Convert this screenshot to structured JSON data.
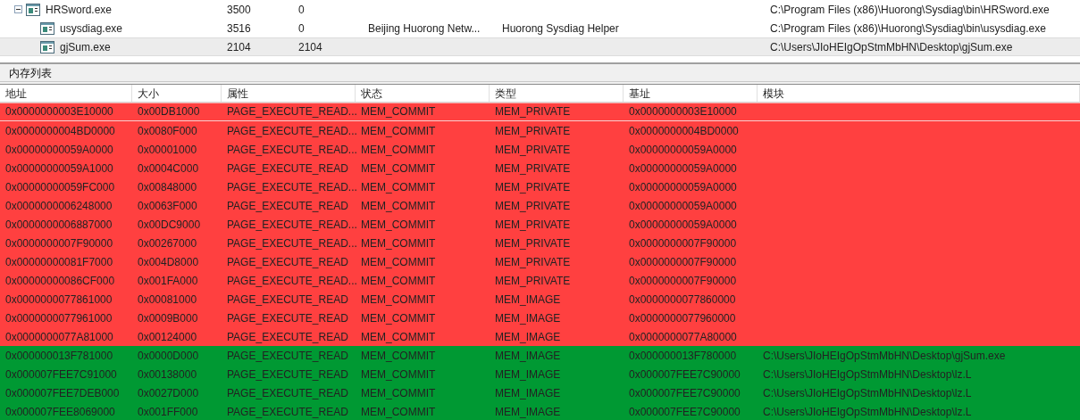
{
  "processes": [
    {
      "name": "HRSword.exe",
      "pid": "3500",
      "parent_pid": "0",
      "path": "C:\\Program Files (x86)\\Huorong\\Sysdiag\\bin\\HRSword.exe",
      "expanded": true,
      "selected": false,
      "children": [
        {
          "name": "usysdiag.exe",
          "pid": "3516",
          "parent_pid": "0",
          "company": "Beijing Huorong Netw...",
          "description": "Huorong Sysdiag Helper",
          "path": "C:\\Program Files (x86)\\Huorong\\Sysdiag\\bin\\usysdiag.exe",
          "selected": false
        },
        {
          "name": "gjSum.exe",
          "pid": "2104",
          "parent_pid": "2104",
          "path": "C:\\Users\\JIoHEIgOpStmMbHN\\Desktop\\gjSum.exe",
          "selected": true
        }
      ]
    }
  ],
  "memory_panel": {
    "title": "内存列表",
    "columns": [
      "地址",
      "大小",
      "属性",
      "状态",
      "类型",
      "基址",
      "模块"
    ],
    "rows": [
      {
        "cells": [
          "0x0000000003E10000",
          "0x00DB1000",
          "PAGE_EXECUTE_READ...",
          "MEM_COMMIT",
          "MEM_PRIVATE",
          "0x0000000003E10000"
        ],
        "color": "#ff4040",
        "selected": true
      },
      {
        "cells": [
          "0x0000000004BD0000",
          "0x0080F000",
          "PAGE_EXECUTE_READ...",
          "MEM_COMMIT",
          "MEM_PRIVATE",
          "0x0000000004BD0000"
        ],
        "color": "#ff4040",
        "selected": false
      },
      {
        "cells": [
          "0x00000000059A0000",
          "0x00001000",
          "PAGE_EXECUTE_READ...",
          "MEM_COMMIT",
          "MEM_PRIVATE",
          "0x00000000059A0000"
        ],
        "color": "#ff4040",
        "selected": false
      },
      {
        "cells": [
          "0x00000000059A1000",
          "0x0004C000",
          "PAGE_EXECUTE_READ",
          "MEM_COMMIT",
          "MEM_PRIVATE",
          "0x00000000059A0000"
        ],
        "color": "#ff4040",
        "selected": false
      },
      {
        "cells": [
          "0x00000000059FC000",
          "0x00848000",
          "PAGE_EXECUTE_READ...",
          "MEM_COMMIT",
          "MEM_PRIVATE",
          "0x00000000059A0000"
        ],
        "color": "#ff4040",
        "selected": false
      },
      {
        "cells": [
          "0x0000000006248000",
          "0x0063F000",
          "PAGE_EXECUTE_READ",
          "MEM_COMMIT",
          "MEM_PRIVATE",
          "0x00000000059A0000"
        ],
        "color": "#ff4040",
        "selected": false
      },
      {
        "cells": [
          "0x0000000006887000",
          "0x00DC9000",
          "PAGE_EXECUTE_READ...",
          "MEM_COMMIT",
          "MEM_PRIVATE",
          "0x00000000059A0000"
        ],
        "color": "#ff4040",
        "selected": false
      },
      {
        "cells": [
          "0x0000000007F90000",
          "0x00267000",
          "PAGE_EXECUTE_READ...",
          "MEM_COMMIT",
          "MEM_PRIVATE",
          "0x0000000007F90000"
        ],
        "color": "#ff4040",
        "selected": false
      },
      {
        "cells": [
          "0x00000000081F7000",
          "0x004D8000",
          "PAGE_EXECUTE_READ",
          "MEM_COMMIT",
          "MEM_PRIVATE",
          "0x0000000007F90000"
        ],
        "color": "#ff4040",
        "selected": false
      },
      {
        "cells": [
          "0x00000000086CF000",
          "0x001FA000",
          "PAGE_EXECUTE_READ...",
          "MEM_COMMIT",
          "MEM_PRIVATE",
          "0x0000000007F90000"
        ],
        "color": "#ff4040",
        "selected": false
      },
      {
        "cells": [
          "0x0000000077861000",
          "0x00081000",
          "PAGE_EXECUTE_READ",
          "MEM_COMMIT",
          "MEM_IMAGE",
          "0x0000000077860000"
        ],
        "color": "#ff4040",
        "selected": false
      },
      {
        "cells": [
          "0x0000000077961000",
          "0x0009B000",
          "PAGE_EXECUTE_READ",
          "MEM_COMMIT",
          "MEM_IMAGE",
          "0x0000000077960000"
        ],
        "color": "#ff4040",
        "selected": false
      },
      {
        "cells": [
          "0x0000000077A81000",
          "0x00124000",
          "PAGE_EXECUTE_READ",
          "MEM_COMMIT",
          "MEM_IMAGE",
          "0x0000000077A80000"
        ],
        "color": "#ff4040",
        "selected": false
      },
      {
        "cells": [
          "0x000000013F781000",
          "0x0000D000",
          "PAGE_EXECUTE_READ",
          "MEM_COMMIT",
          "MEM_IMAGE",
          "0x000000013F780000",
          "C:\\Users\\JIoHEIgOpStmMbHN\\Desktop\\gjSum.exe"
        ],
        "color": "#009933",
        "selected": false
      },
      {
        "cells": [
          "0x000007FEE7C91000",
          "0x00138000",
          "PAGE_EXECUTE_READ",
          "MEM_COMMIT",
          "MEM_IMAGE",
          "0x000007FEE7C90000",
          "C:\\Users\\JIoHEIgOpStmMbHN\\Desktop\\lz.L"
        ],
        "color": "#009933",
        "selected": false
      },
      {
        "cells": [
          "0x000007FEE7DEB000",
          "0x0027D000",
          "PAGE_EXECUTE_READ",
          "MEM_COMMIT",
          "MEM_IMAGE",
          "0x000007FEE7C90000",
          "C:\\Users\\JIoHEIgOpStmMbHN\\Desktop\\lz.L"
        ],
        "color": "#009933",
        "selected": false
      },
      {
        "cells": [
          "0x000007FEE8069000",
          "0x001FF000",
          "PAGE_EXECUTE_READ",
          "MEM_COMMIT",
          "MEM_IMAGE",
          "0x000007FEE7C90000",
          "C:\\Users\\JIoHEIgOpStmMbHN\\Desktop\\lz.L"
        ],
        "color": "#009933",
        "selected": false
      }
    ]
  }
}
